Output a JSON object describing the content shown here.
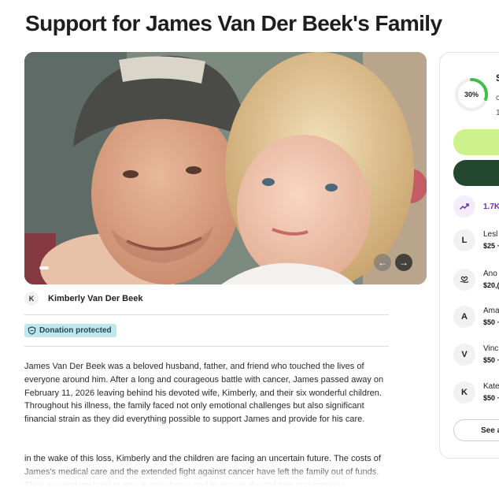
{
  "page": {
    "title": "Support for James Van Der Beek's Family"
  },
  "organizer": {
    "initial": "K",
    "name": "Kimberly Van Der Beek"
  },
  "badge": {
    "label": "Donation protected",
    "icon": "shield-icon"
  },
  "story": {
    "paragraph_1": "James Van Der Beek was a beloved husband, father, and friend who touched the lives of everyone around him. After a long and courageous battle with cancer, James passed away on February 11, 2026 leaving behind his devoted wife, Kimberly, and their six wonderful children. Throughout his illness, the family faced not only emotional challenges but also significant financial strain as they did everything possible to support James and provide for his care.",
    "paragraph_2": "in the wake of this loss, Kimberly and the children are facing an uncertain future. The costs of James's medical care and the extended fight against cancer have left the family out of funds. They are working hard to stay in their home and to ensure the children can continue"
  },
  "carousel": {
    "prev_icon": "arrow-left-icon",
    "next_icon": "arrow-right-icon",
    "prev_glyph": "←",
    "next_glyph": "→"
  },
  "sidebar": {
    "progress_label": "30%",
    "progress_fraction": 0.3,
    "raised_partial": "S",
    "goal_partial_1": "c",
    "goal_partial_2": "1",
    "trend_icon": "trending-up-icon",
    "trend_text": "1.7K",
    "donors": [
      {
        "initial": "L",
        "name": "Lesl",
        "amount": "$25 ·"
      },
      {
        "initial": "",
        "icon": "heart-hand-icon",
        "name": "Ano",
        "amount": "$20,("
      },
      {
        "initial": "A",
        "name": "Ama",
        "amount": "$50 ·"
      },
      {
        "initial": "V",
        "name": "Vinc",
        "amount": "$50 ·"
      },
      {
        "initial": "K",
        "name": "Kate",
        "amount": "$50 ·"
      }
    ],
    "see_all_label": "See a"
  },
  "colors": {
    "accent_green": "#cdf28b",
    "dark_green": "#24472f",
    "progress_green": "#3fbf4a",
    "badge_bg": "#bfe7ec",
    "trend_purple": "#6d2fa8"
  }
}
